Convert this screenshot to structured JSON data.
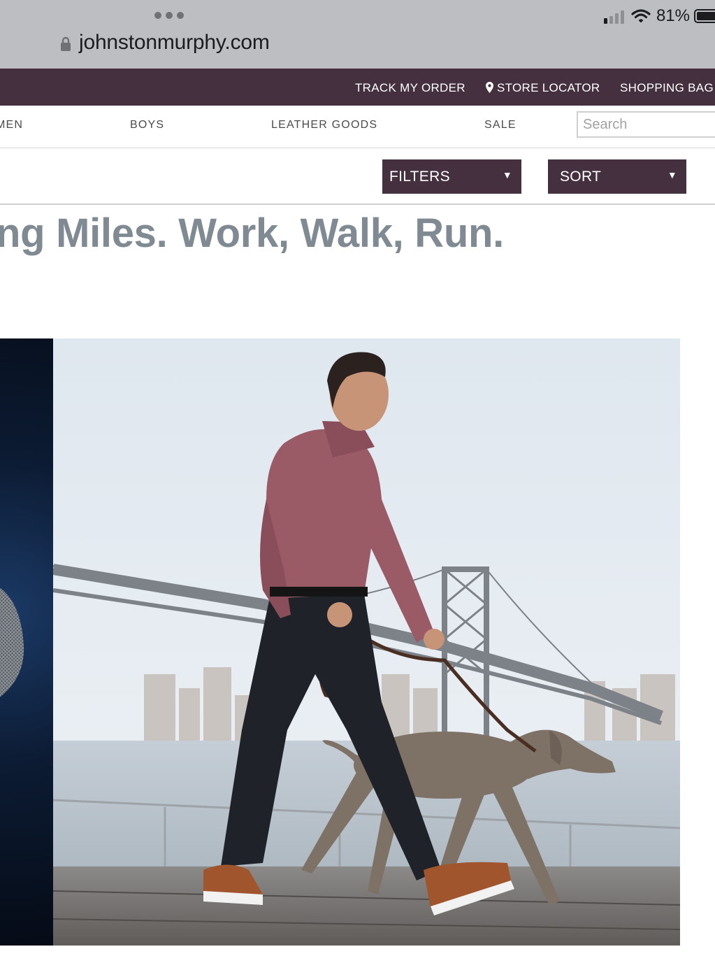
{
  "status_bar": {
    "battery_percent": "81%",
    "signal_bars": 4,
    "signal_bars_filled": 1,
    "wifi": "wifi-icon"
  },
  "browser": {
    "url": "johnstonmurphy.com",
    "lock_icon": "lock-icon",
    "more_icon": "ellipsis-icon"
  },
  "utility_nav": {
    "track_order": "TRACK MY ORDER",
    "store_locator": "STORE LOCATOR",
    "shopping_bag": "SHOPPING BAG"
  },
  "main_nav": {
    "items": [
      "MEN",
      "BOYS",
      "LEATHER GOODS",
      "SALE"
    ],
    "search_placeholder": "Search"
  },
  "controls": {
    "filters": "FILTERS",
    "sort": "SORT"
  },
  "hero": {
    "headline": "ng Miles. Work, Walk, Run."
  },
  "colors": {
    "brand_plum": "#45303f",
    "headline_gray": "#7f8a93",
    "chrome_gray": "#bcbec1"
  }
}
